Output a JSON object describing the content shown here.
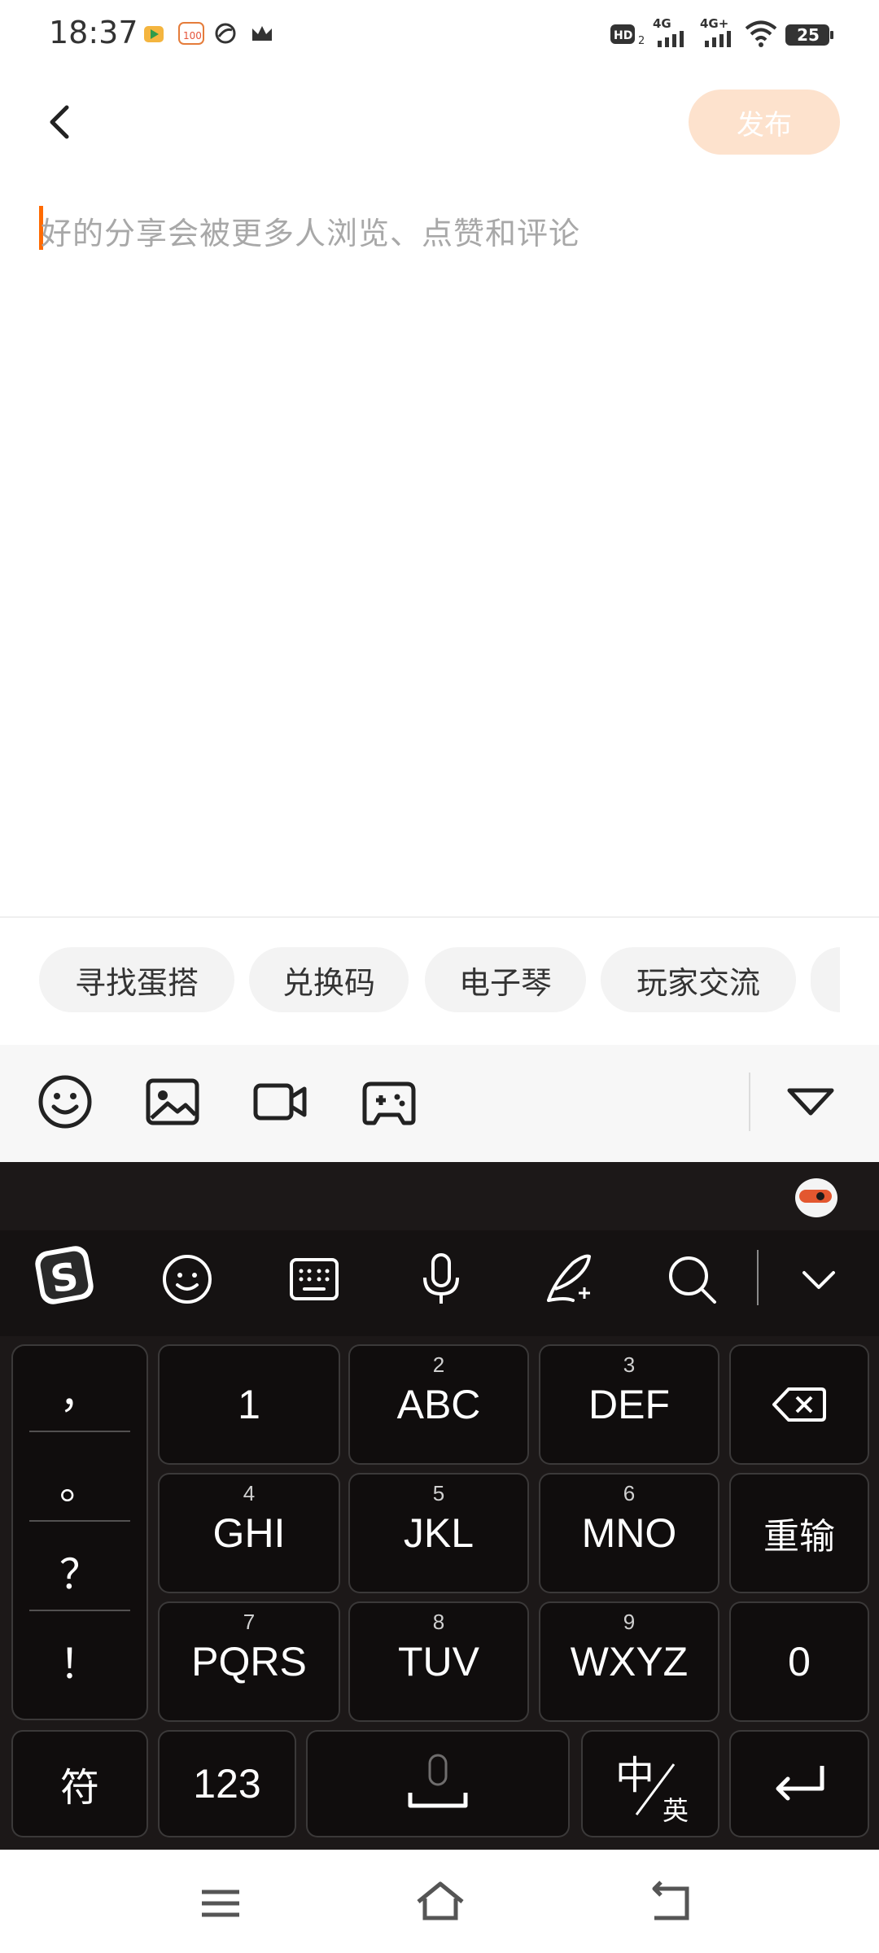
{
  "status_bar": {
    "time": "18:37",
    "battery": "25",
    "network_1": "4G",
    "network_2": "4G+",
    "hd_label": "HD",
    "hd_sub": "2"
  },
  "header": {
    "back_icon": "chevron-left-icon",
    "publish_label": "发布"
  },
  "editor": {
    "placeholder": "好的分享会被更多人浏览、点赞和评论"
  },
  "topic_chips": [
    "寻找蛋搭",
    "兑换码",
    "电子琴",
    "玩家交流"
  ],
  "toolbar": {
    "icons": [
      "emoji-icon",
      "image-icon",
      "video-icon",
      "gamepad-icon"
    ],
    "collapse_icon": "triangle-down-icon"
  },
  "keyboard": {
    "toolbar_icons": [
      "sogou-logo",
      "smiley-icon",
      "keyboard-icon",
      "microphone-icon",
      "handwriting-icon",
      "search-icon",
      "chevron-down-icon"
    ],
    "punctuation": [
      "，",
      "。",
      "？",
      "！"
    ],
    "keys": {
      "k1": "1",
      "k2": "ABC",
      "k2_num": "2",
      "k3": "DEF",
      "k3_num": "3",
      "k4": "GHI",
      "k4_num": "4",
      "k5": "JKL",
      "k5_num": "5",
      "k6": "MNO",
      "k6_num": "6",
      "k7": "PQRS",
      "k7_num": "7",
      "k8": "TUV",
      "k8_num": "8",
      "k9": "WXYZ",
      "k9_num": "9",
      "k0": "0",
      "reinput": "重输",
      "symbols": "符",
      "numbers": "123",
      "zh": "中",
      "en": "英"
    }
  },
  "accent_color": "#ff6a00",
  "publish_bg": "#fde2cd"
}
